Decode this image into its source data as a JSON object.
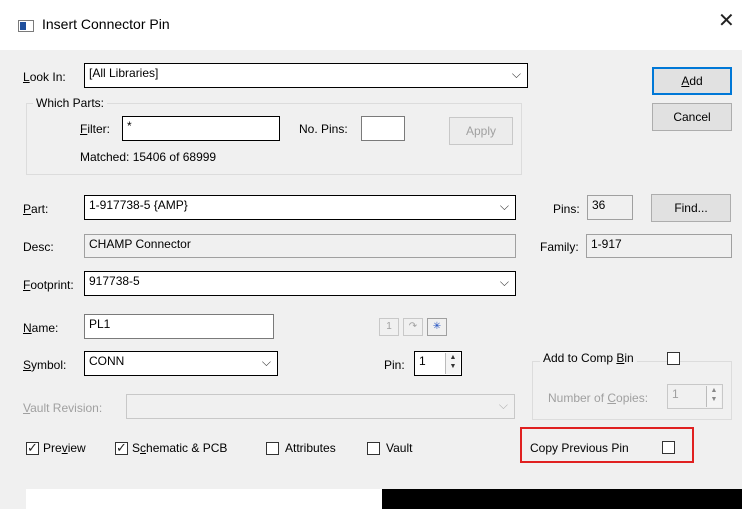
{
  "window": {
    "title": "Insert Connector Pin",
    "close_glyph": "✕"
  },
  "look_in": {
    "label_pre": "",
    "label_acc": "L",
    "label_post": "ook In:",
    "value": "[All Libraries]"
  },
  "which_parts": {
    "title": "Which Parts:",
    "filter_label_acc": "F",
    "filter_label_post": "ilter:",
    "filter_value": "*",
    "no_pins_label": "No. Pins:",
    "no_pins_value": "",
    "apply_label": "Apply",
    "matched": "Matched: 15406 of 68999"
  },
  "buttons": {
    "add_acc": "A",
    "add_post": "dd",
    "cancel": "Cancel",
    "find": "Find..."
  },
  "part": {
    "label_acc": "P",
    "label_post": "art:",
    "value": "1-917738-5 {AMP}"
  },
  "pins": {
    "label": "Pins:",
    "value": "36"
  },
  "desc": {
    "label": "Desc:",
    "value": "CHAMP Connector"
  },
  "family": {
    "label": "Family:",
    "value": "1-917"
  },
  "footprint": {
    "label_acc": "F",
    "label_post": "ootprint:",
    "value": "917738-5"
  },
  "name": {
    "label_acc": "N",
    "label_post": "ame:",
    "value": "PL1"
  },
  "toolbar": {
    "icon1": "1",
    "icon2": "↷",
    "icon3": "✳"
  },
  "symbol": {
    "label_acc": "S",
    "label_post": "ymbol:",
    "value": "CONN"
  },
  "pin": {
    "label": "Pin:",
    "value": "1"
  },
  "add_to_comp_bin": {
    "label_pre": "Add to Comp ",
    "label_acc": "B",
    "label_post": "in"
  },
  "number_of_copies": {
    "label_pre": "Number of ",
    "label_acc": "C",
    "label_post": "opies:",
    "value": "1"
  },
  "vault_revision": {
    "label_acc": "V",
    "label_post": "ault Revision:",
    "value": ""
  },
  "checkboxes": {
    "preview_pre": "Pre",
    "preview_acc": "v",
    "preview_post": "iew",
    "schematic_pre": "S",
    "schematic_acc": "c",
    "schematic_post": "hematic & PCB",
    "attributes": "Attributes",
    "vault": "Vault",
    "copy_previous_pin": "Copy Previous Pin"
  },
  "state": {
    "preview_checked": true,
    "schematic_checked": true,
    "attributes_checked": false,
    "vault_checked": false,
    "copy_previous_checked": false,
    "add_to_comp_bin_checked": false
  },
  "colors": {
    "accent": "#0078d7",
    "highlight": "#e02020",
    "preview_dark": "#000000"
  }
}
